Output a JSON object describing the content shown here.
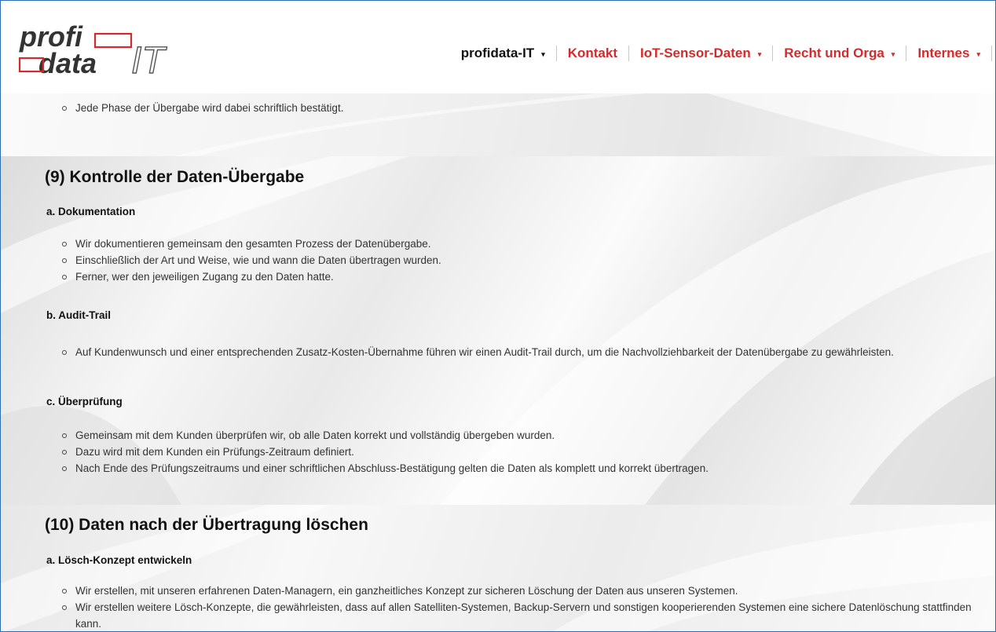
{
  "nav": {
    "items": [
      {
        "label": "profidata-IT",
        "dropdown": true
      },
      {
        "label": "Kontakt",
        "dropdown": false
      },
      {
        "label": "IoT-Sensor-Daten",
        "dropdown": true
      },
      {
        "label": "Recht und Orga",
        "dropdown": true
      },
      {
        "label": "Internes",
        "dropdown": true
      }
    ],
    "caret": "▾"
  },
  "logo": {
    "line1": "profi",
    "line2": "data",
    "suffix": "IT"
  },
  "intro_bullet": "Jede Phase der Übergabe wird dabei schriftlich bestätigt.",
  "section9": {
    "title": "(9) Kontrolle der Daten-Übergabe",
    "a_title": "a. Dokumentation",
    "a_items": [
      "Wir dokumentieren gemeinsam den gesamten Prozess der Datenübergabe.",
      "Einschließlich der Art und Weise, wie und wann die Daten übertragen wurden.",
      "Ferner, wer den jeweiligen Zugang zu den Daten hatte."
    ],
    "b_title": "b. Audit-Trail",
    "b_items": [
      "Auf Kundenwunsch und einer entsprechenden Zusatz-Kosten-Übernahme führen wir einen Audit-Trail durch, um die Nachvollziehbarkeit der Datenübergabe zu gewährleisten."
    ],
    "c_title": "c. Überprüfung",
    "c_items": [
      "Gemeinsam mit dem Kunden überprüfen wir, ob alle Daten korrekt und vollständig übergeben wurden.",
      "Dazu wird mit dem Kunden ein Prüfungs-Zeitraum definiert.",
      "Nach Ende des Prüfungszeitraums und einer schriftlichen Abschluss-Bestätigung gelten die Daten als komplett und korrekt übertragen."
    ]
  },
  "section10": {
    "title": "(10) Daten nach der Übertragung löschen",
    "a_title": "a. Lösch-Konzept entwickeln",
    "a_items": [
      "Wir erstellen, mit unseren erfahrenen Daten-Managern, ein ganzheitliches Konzept zur sicheren Löschung der Daten aus unseren Systemen.",
      "Wir erstellen weitere Lösch-Konzepte, die gewährleisten, dass auf allen Satelliten-Systemen, Backup-Servern und sonstigen kooperierenden Systemen eine sichere Datenlöschung stattfinden kann."
    ]
  },
  "colors": {
    "accent": "#d22b2b",
    "frame": "#2f6db3",
    "text": "#333333"
  }
}
